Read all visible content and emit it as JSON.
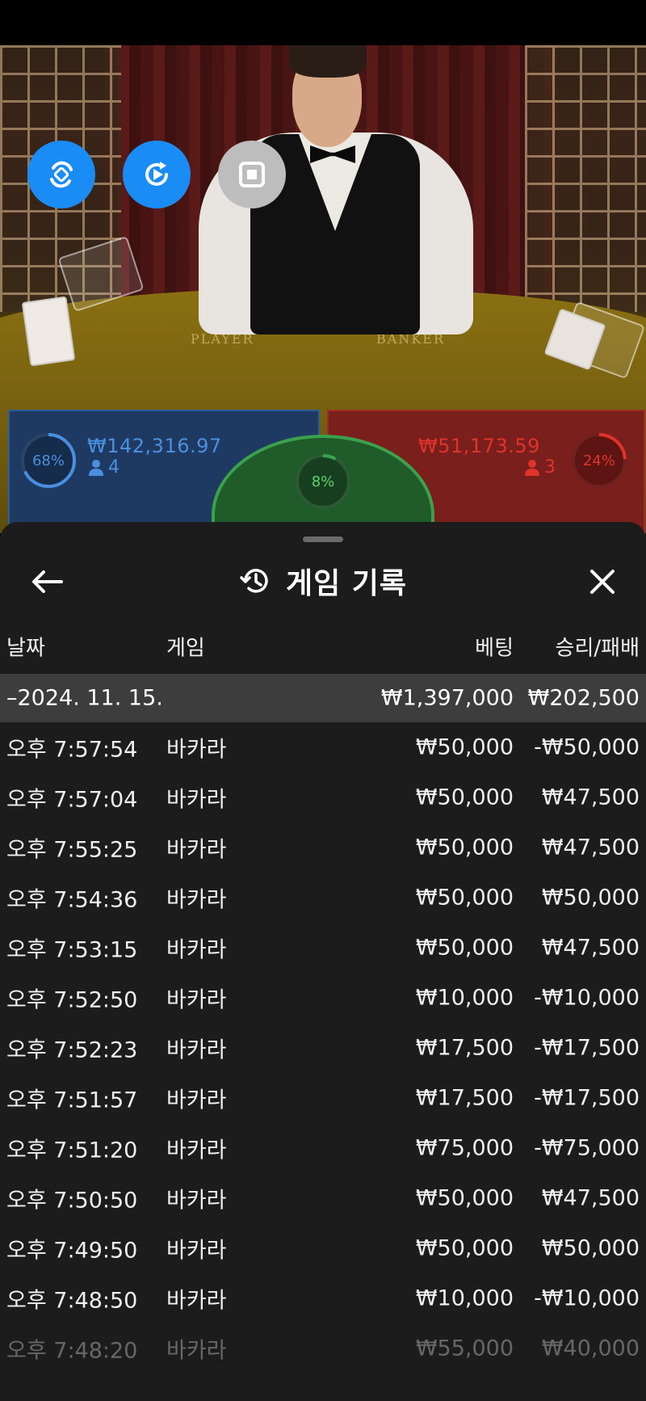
{
  "video": {
    "felt_left": "PLAYER",
    "felt_right": "BANKER",
    "controls": [
      {
        "name": "rotate-view-icon",
        "color": "#1a8cf5"
      },
      {
        "name": "replay-icon",
        "color": "#1a8cf5"
      },
      {
        "name": "stop-icon",
        "color": "#bdbdbd"
      }
    ]
  },
  "stats": {
    "player": {
      "percent": "68%",
      "percent_value": 68,
      "amount": "₩142,316.97",
      "count": "4",
      "color": "#4a8fe0"
    },
    "tie": {
      "percent": "8%",
      "percent_value": 8,
      "color": "#3ba14c"
    },
    "banker": {
      "percent": "24%",
      "percent_value": 24,
      "amount": "₩51,173.59",
      "count": "3",
      "color": "#e0332b"
    }
  },
  "sheet": {
    "title": "게임 기록",
    "icons": {
      "back": "back-arrow-icon",
      "history": "history-icon",
      "close": "close-icon"
    },
    "columns": {
      "date": "날짜",
      "game": "게임",
      "bet": "베팅",
      "win_loss": "승리/패배"
    },
    "day_group": {
      "date": "–2024. 11. 15.",
      "total_bet": "₩1,397,000",
      "total_win_loss": "₩202,500"
    },
    "rows": [
      {
        "time": "오후 7:57:54",
        "game": "바카라",
        "bet": "₩50,000",
        "win_loss": "-₩50,000"
      },
      {
        "time": "오후 7:57:04",
        "game": "바카라",
        "bet": "₩50,000",
        "win_loss": "₩47,500"
      },
      {
        "time": "오후 7:55:25",
        "game": "바카라",
        "bet": "₩50,000",
        "win_loss": "₩47,500"
      },
      {
        "time": "오후 7:54:36",
        "game": "바카라",
        "bet": "₩50,000",
        "win_loss": "₩50,000"
      },
      {
        "time": "오후 7:53:15",
        "game": "바카라",
        "bet": "₩50,000",
        "win_loss": "₩47,500"
      },
      {
        "time": "오후 7:52:50",
        "game": "바카라",
        "bet": "₩10,000",
        "win_loss": "-₩10,000"
      },
      {
        "time": "오후 7:52:23",
        "game": "바카라",
        "bet": "₩17,500",
        "win_loss": "-₩17,500"
      },
      {
        "time": "오후 7:51:57",
        "game": "바카라",
        "bet": "₩17,500",
        "win_loss": "-₩17,500"
      },
      {
        "time": "오후 7:51:20",
        "game": "바카라",
        "bet": "₩75,000",
        "win_loss": "-₩75,000"
      },
      {
        "time": "오후 7:50:50",
        "game": "바카라",
        "bet": "₩50,000",
        "win_loss": "₩47,500"
      },
      {
        "time": "오후 7:49:50",
        "game": "바카라",
        "bet": "₩50,000",
        "win_loss": "₩50,000"
      },
      {
        "time": "오후 7:48:50",
        "game": "바카라",
        "bet": "₩10,000",
        "win_loss": "-₩10,000"
      },
      {
        "time": "오후 7:48:20",
        "game": "바카라",
        "bet": "₩55,000",
        "win_loss": "₩40,000"
      }
    ]
  }
}
